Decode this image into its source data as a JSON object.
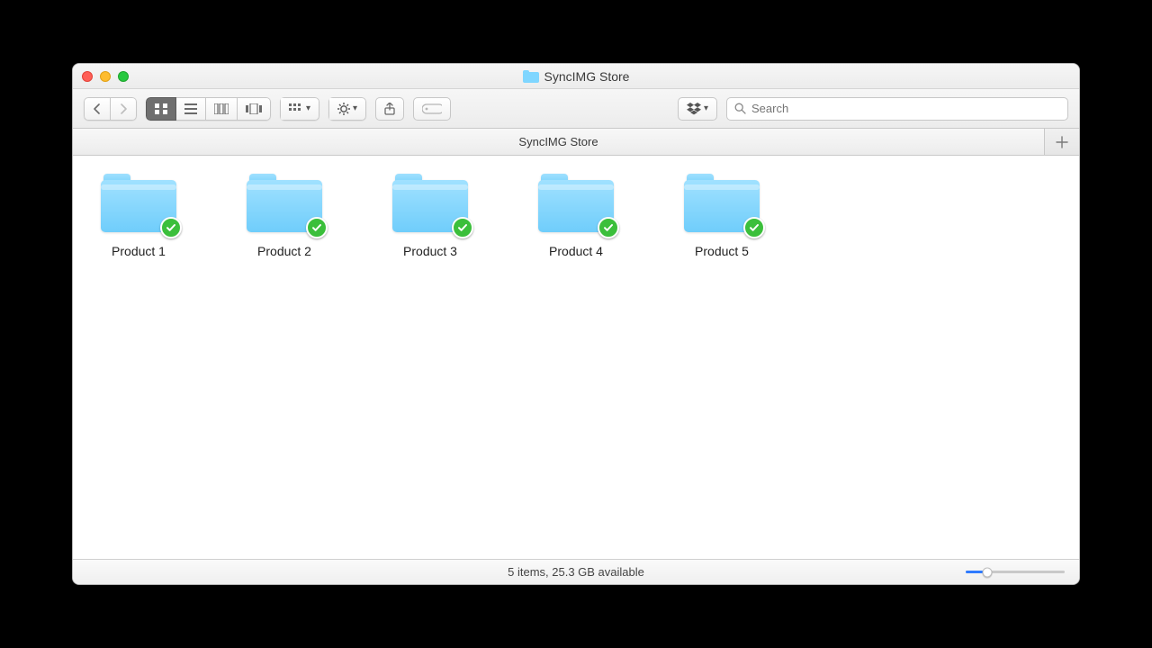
{
  "window": {
    "title": "SyncIMG Store"
  },
  "tabs": [
    {
      "label": "SyncIMG Store"
    }
  ],
  "search": {
    "placeholder": "Search"
  },
  "items": [
    {
      "label": "Product 1"
    },
    {
      "label": "Product 2"
    },
    {
      "label": "Product 3"
    },
    {
      "label": "Product 4"
    },
    {
      "label": "Product 5"
    }
  ],
  "status": {
    "text": "5 items, 25.3 GB available"
  }
}
